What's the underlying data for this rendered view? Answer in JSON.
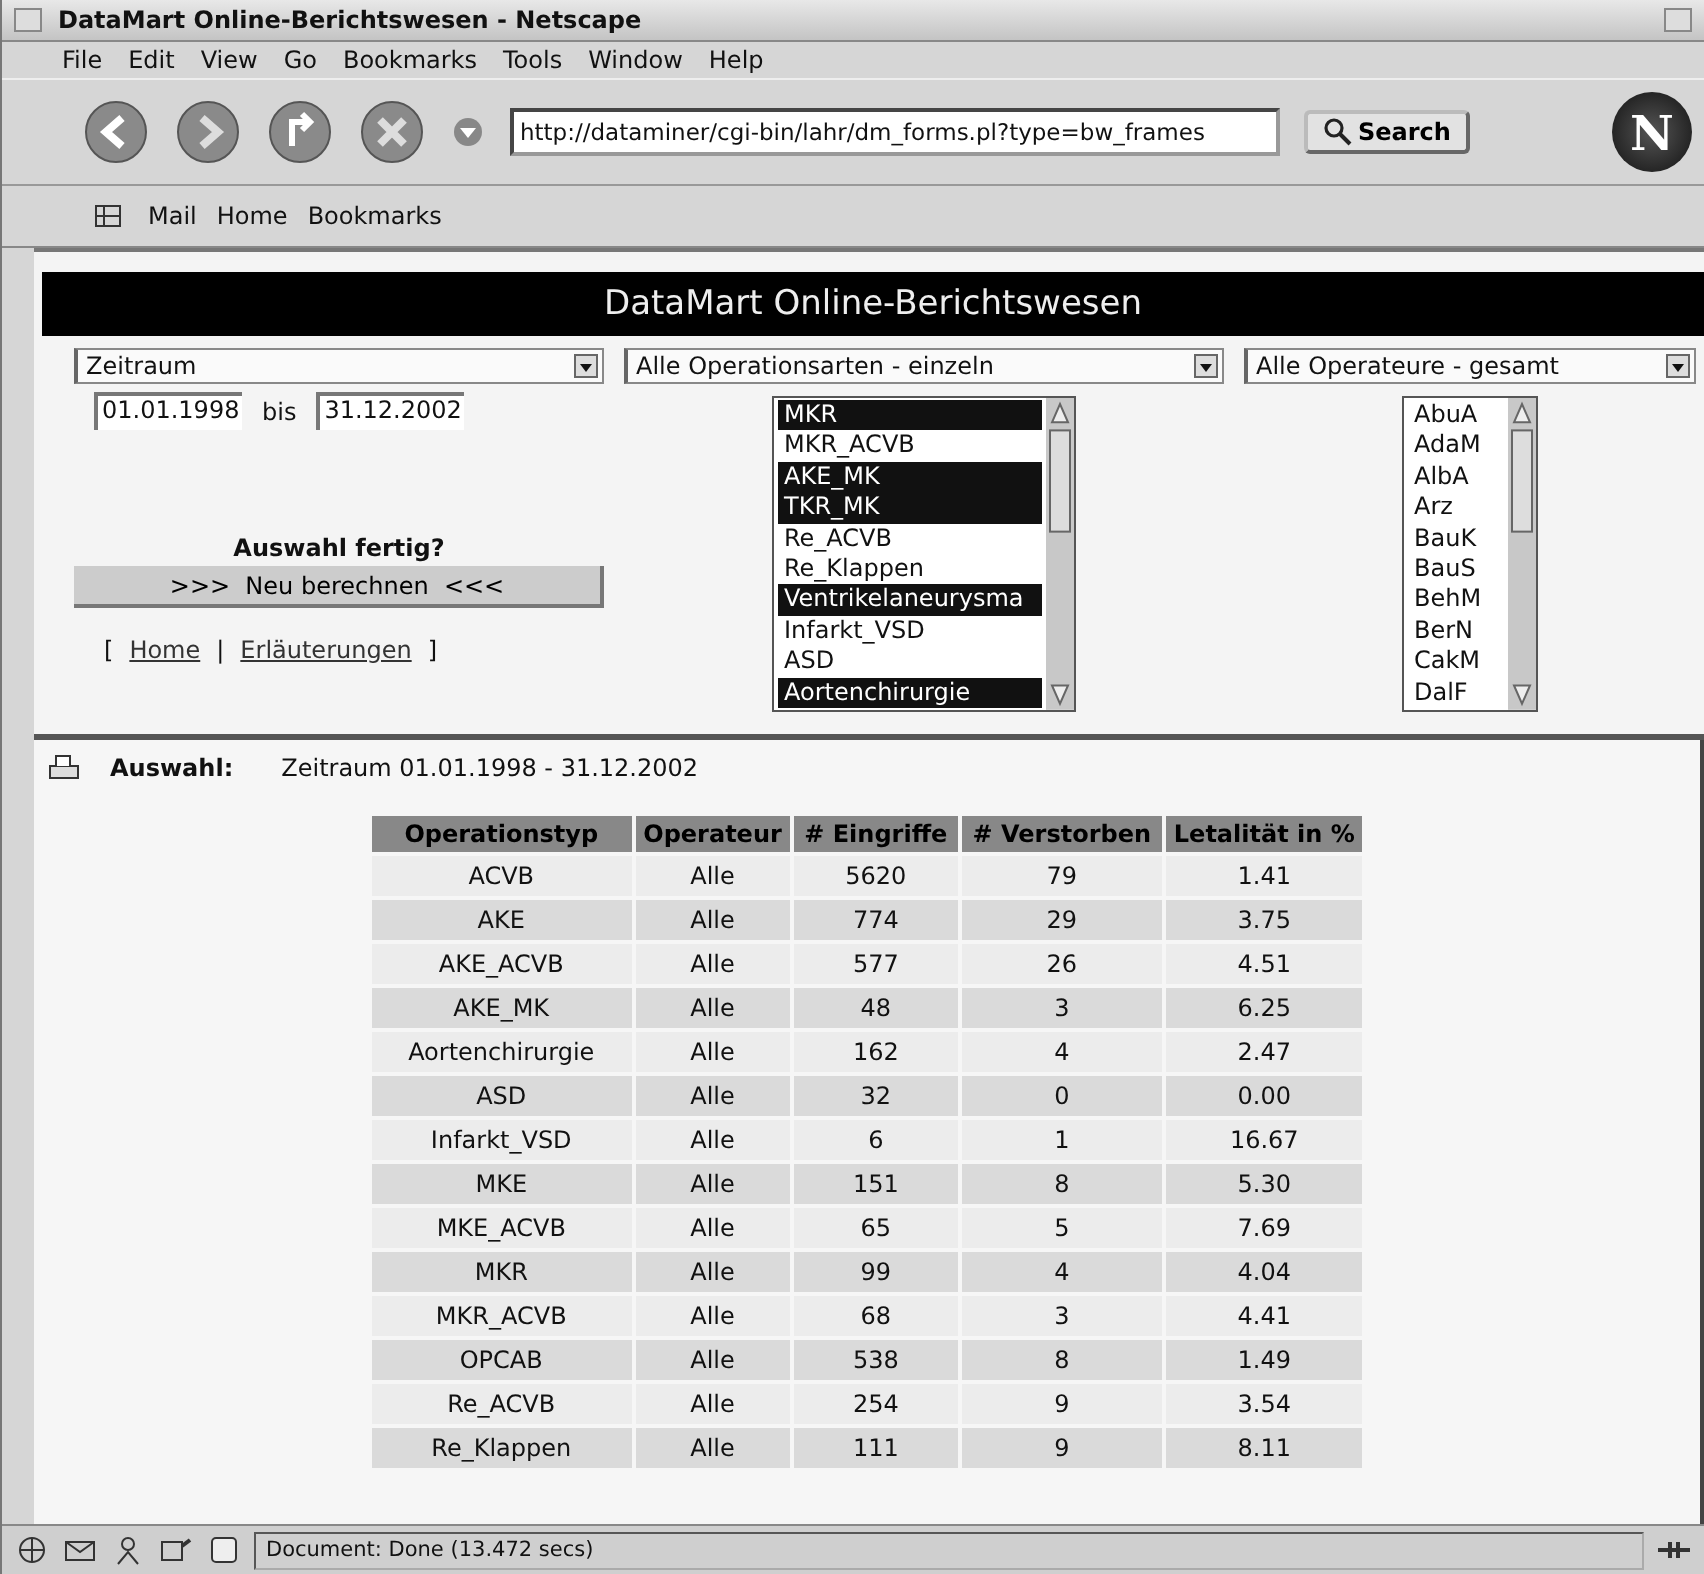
{
  "window": {
    "title": "DataMart Online-Berichtswesen - Netscape"
  },
  "menu": [
    "File",
    "Edit",
    "View",
    "Go",
    "Bookmarks",
    "Tools",
    "Window",
    "Help"
  ],
  "navigation": {
    "url": "http://dataminer/cgi-bin/lahr/dm_forms.pl?type=bw_frames",
    "search_label": "Search",
    "logo_text": "N"
  },
  "personal_toolbar": [
    "Mail",
    "Home",
    "Bookmarks"
  ],
  "header": {
    "title": "DataMart Online-Berichtswesen"
  },
  "form": {
    "period_select": "Zeitraum",
    "date_from": "01.01.1998",
    "date_separator": "bis",
    "date_to": "31.12.2002",
    "done_prompt": "Auswahl fertig?",
    "recalc_button": ">>>  Neu berechnen  <<<",
    "links": [
      {
        "bracket_open": "[",
        "label": "Home",
        "separator": "|"
      },
      {
        "label": "Erläuterungen",
        "bracket_close": "]"
      }
    ],
    "operations_select": "Alle Operationsarten - einzeln",
    "operations": [
      {
        "label": "MKR",
        "selected": true
      },
      {
        "label": "MKR_ACVB",
        "selected": false
      },
      {
        "label": "AKE_MK",
        "selected": true
      },
      {
        "label": "TKR_MK",
        "selected": true
      },
      {
        "label": "Re_ACVB",
        "selected": false
      },
      {
        "label": "Re_Klappen",
        "selected": false
      },
      {
        "label": "Ventrikelaneurysma",
        "selected": true
      },
      {
        "label": "Infarkt_VSD",
        "selected": false
      },
      {
        "label": "ASD",
        "selected": false
      },
      {
        "label": "Aortenchirurgie",
        "selected": true
      }
    ],
    "surgeons_select": "Alle Operateure - gesamt",
    "surgeons": [
      {
        "label": "AbuA",
        "selected": false
      },
      {
        "label": "AdaM",
        "selected": false
      },
      {
        "label": "AlbA",
        "selected": false
      },
      {
        "label": "Arz",
        "selected": false
      },
      {
        "label": "BauK",
        "selected": false
      },
      {
        "label": "BauS",
        "selected": false
      },
      {
        "label": "BehM",
        "selected": false
      },
      {
        "label": "BerN",
        "selected": false
      },
      {
        "label": "CakM",
        "selected": false
      },
      {
        "label": "DalF",
        "selected": false
      }
    ]
  },
  "selection": {
    "label": "Auswahl:",
    "value": "Zeitraum 01.01.1998 - 31.12.2002"
  },
  "table": {
    "columns": [
      "Operationstyp",
      "Operateur",
      "# Eingriffe",
      "# Verstorben",
      "Letalität in %"
    ],
    "rows": [
      [
        "ACVB",
        "Alle",
        "5620",
        "79",
        "1.41"
      ],
      [
        "AKE",
        "Alle",
        "774",
        "29",
        "3.75"
      ],
      [
        "AKE_ACVB",
        "Alle",
        "577",
        "26",
        "4.51"
      ],
      [
        "AKE_MK",
        "Alle",
        "48",
        "3",
        "6.25"
      ],
      [
        "Aortenchirurgie",
        "Alle",
        "162",
        "4",
        "2.47"
      ],
      [
        "ASD",
        "Alle",
        "32",
        "0",
        "0.00"
      ],
      [
        "Infarkt_VSD",
        "Alle",
        "6",
        "1",
        "16.67"
      ],
      [
        "MKE",
        "Alle",
        "151",
        "8",
        "5.30"
      ],
      [
        "MKE_ACVB",
        "Alle",
        "65",
        "5",
        "7.69"
      ],
      [
        "MKR",
        "Alle",
        "99",
        "4",
        "4.04"
      ],
      [
        "MKR_ACVB",
        "Alle",
        "68",
        "3",
        "4.41"
      ],
      [
        "OPCAB",
        "Alle",
        "538",
        "8",
        "1.49"
      ],
      [
        "Re_ACVB",
        "Alle",
        "254",
        "9",
        "3.54"
      ],
      [
        "Re_Klappen",
        "Alle",
        "111",
        "9",
        "8.11"
      ]
    ]
  },
  "status_bar": {
    "text": "Document: Done (13.472 secs)"
  }
}
